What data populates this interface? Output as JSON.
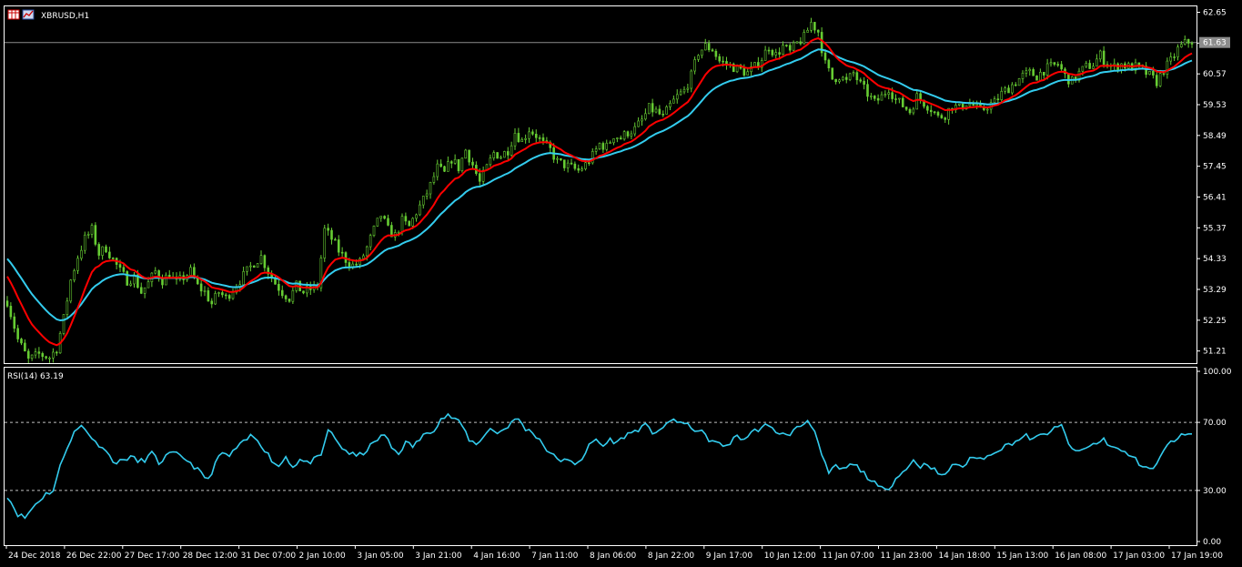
{
  "window": {
    "symbol_label": "XBRUSD,H1",
    "icons": [
      "grid-icon",
      "chart-icon"
    ]
  },
  "colors": {
    "background": "#000000",
    "frame": "#ffffff",
    "bull_candle": "#66cc33",
    "fast_ma": "#ff0000",
    "slow_ma": "#33ccee",
    "rsi_line": "#33ccee",
    "current_price_line": "#8c8c8c",
    "current_price_label_bg": "#8c8c8c"
  },
  "chart_data": [
    {
      "type": "candlestick",
      "name_label": "",
      "ylim": [
        50.8,
        62.85
      ],
      "y_ticks": [
        "62.65",
        "61.61",
        "60.57",
        "59.53",
        "58.49",
        "57.45",
        "56.41",
        "55.37",
        "54.33",
        "53.29",
        "52.25",
        "51.21"
      ],
      "current_price": 61.63,
      "current_price_label": "61.63",
      "x_ticks": [
        "24 Dec 2018",
        "26 Dec 22:00",
        "27 Dec 17:00",
        "28 Dec 12:00",
        "31 Dec 07:00",
        "2 Jan 10:00",
        "3 Jan 05:00",
        "3 Jan 21:00",
        "4 Jan 16:00",
        "7 Jan 11:00",
        "8 Jan 06:00",
        "8 Jan 22:00",
        "9 Jan 17:00",
        "10 Jan 12:00",
        "11 Jan 07:00",
        "11 Jan 23:00",
        "14 Jan 18:00",
        "15 Jan 13:00",
        "16 Jan 08:00",
        "17 Jan 03:00",
        "17 Jan 19:00"
      ],
      "close_path": [
        [
          0,
          52.9
        ],
        [
          3,
          51.6
        ],
        [
          6,
          50.9
        ],
        [
          9,
          51.1
        ],
        [
          12,
          51.0
        ],
        [
          14,
          51.3
        ],
        [
          16,
          52.3
        ],
        [
          18,
          53.6
        ],
        [
          20,
          54.4
        ],
        [
          22,
          55.0
        ],
        [
          24,
          55.3
        ],
        [
          26,
          54.5
        ],
        [
          28,
          54.7
        ],
        [
          30,
          54.3
        ],
        [
          32,
          53.9
        ],
        [
          34,
          53.6
        ],
        [
          36,
          53.7
        ],
        [
          38,
          53.2
        ],
        [
          40,
          53.5
        ],
        [
          42,
          53.9
        ],
        [
          44,
          53.6
        ],
        [
          46,
          53.8
        ],
        [
          48,
          53.5
        ],
        [
          50,
          53.7
        ],
        [
          52,
          53.9
        ],
        [
          54,
          53.4
        ],
        [
          56,
          53.2
        ],
        [
          58,
          52.8
        ],
        [
          60,
          53.2
        ],
        [
          62,
          53.0
        ],
        [
          64,
          53.3
        ],
        [
          66,
          53.6
        ],
        [
          68,
          53.9
        ],
        [
          70,
          54.2
        ],
        [
          72,
          54.4
        ],
        [
          74,
          53.9
        ],
        [
          76,
          53.5
        ],
        [
          78,
          53.2
        ],
        [
          80,
          53.0
        ],
        [
          82,
          53.4
        ],
        [
          84,
          53.2
        ],
        [
          86,
          53.3
        ],
        [
          88,
          53.4
        ],
        [
          90,
          55.3
        ],
        [
          92,
          55.0
        ],
        [
          94,
          54.6
        ],
        [
          96,
          54.3
        ],
        [
          98,
          54.1
        ],
        [
          100,
          54.2
        ],
        [
          102,
          54.7
        ],
        [
          104,
          55.3
        ],
        [
          106,
          55.8
        ],
        [
          108,
          55.3
        ],
        [
          110,
          55.1
        ],
        [
          112,
          55.6
        ],
        [
          114,
          55.4
        ],
        [
          116,
          55.9
        ],
        [
          118,
          56.3
        ],
        [
          120,
          56.8
        ],
        [
          122,
          57.4
        ],
        [
          124,
          57.2
        ],
        [
          126,
          57.7
        ],
        [
          128,
          57.4
        ],
        [
          130,
          58.0
        ],
        [
          132,
          57.5
        ],
        [
          134,
          56.9
        ],
        [
          136,
          57.4
        ],
        [
          138,
          57.9
        ],
        [
          140,
          57.8
        ],
        [
          142,
          58.0
        ],
        [
          144,
          58.6
        ],
        [
          146,
          58.3
        ],
        [
          148,
          58.7
        ],
        [
          150,
          58.5
        ],
        [
          152,
          58.2
        ],
        [
          154,
          58.0
        ],
        [
          156,
          57.6
        ],
        [
          158,
          57.5
        ],
        [
          160,
          57.4
        ],
        [
          162,
          57.3
        ],
        [
          164,
          57.5
        ],
        [
          166,
          57.8
        ],
        [
          168,
          58.2
        ],
        [
          170,
          58.1
        ],
        [
          172,
          58.5
        ],
        [
          174,
          58.4
        ],
        [
          176,
          58.6
        ],
        [
          178,
          58.7
        ],
        [
          180,
          59.0
        ],
        [
          182,
          59.4
        ],
        [
          184,
          59.3
        ],
        [
          186,
          59.1
        ],
        [
          188,
          59.5
        ],
        [
          190,
          59.8
        ],
        [
          192,
          60.0
        ],
        [
          194,
          60.5
        ],
        [
          196,
          61.3
        ],
        [
          198,
          61.5
        ],
        [
          200,
          61.4
        ],
        [
          202,
          61.0
        ],
        [
          204,
          60.9
        ],
        [
          206,
          60.8
        ],
        [
          208,
          60.7
        ],
        [
          210,
          60.6
        ],
        [
          212,
          60.8
        ],
        [
          214,
          61.1
        ],
        [
          216,
          61.5
        ],
        [
          218,
          61.2
        ],
        [
          220,
          61.5
        ],
        [
          222,
          61.3
        ],
        [
          224,
          61.6
        ],
        [
          226,
          61.8
        ],
        [
          228,
          62.3
        ],
        [
          230,
          62.0
        ],
        [
          232,
          60.9
        ],
        [
          234,
          60.4
        ],
        [
          236,
          60.5
        ],
        [
          238,
          60.3
        ],
        [
          240,
          60.6
        ],
        [
          242,
          60.2
        ],
        [
          244,
          59.9
        ],
        [
          246,
          59.6
        ],
        [
          248,
          59.8
        ],
        [
          250,
          60.1
        ],
        [
          252,
          59.7
        ],
        [
          254,
          59.5
        ],
        [
          256,
          59.3
        ],
        [
          258,
          59.8
        ],
        [
          260,
          59.6
        ],
        [
          262,
          59.4
        ],
        [
          264,
          59.1
        ],
        [
          266,
          59.2
        ],
        [
          268,
          59.5
        ],
        [
          270,
          59.4
        ],
        [
          272,
          59.6
        ],
        [
          274,
          59.5
        ],
        [
          276,
          59.3
        ],
        [
          278,
          59.5
        ],
        [
          280,
          59.6
        ],
        [
          282,
          59.9
        ],
        [
          284,
          60.1
        ],
        [
          286,
          60.3
        ],
        [
          288,
          60.5
        ],
        [
          290,
          60.6
        ],
        [
          292,
          60.5
        ],
        [
          294,
          60.7
        ],
        [
          296,
          60.8
        ],
        [
          298,
          60.9
        ],
        [
          300,
          60.5
        ],
        [
          302,
          60.3
        ],
        [
          304,
          60.6
        ],
        [
          306,
          60.8
        ],
        [
          308,
          60.9
        ],
        [
          310,
          61.2
        ],
        [
          312,
          60.9
        ],
        [
          314,
          60.8
        ],
        [
          316,
          60.9
        ],
        [
          318,
          60.8
        ],
        [
          320,
          60.8
        ],
        [
          322,
          60.7
        ],
        [
          324,
          60.5
        ],
        [
          326,
          60.3
        ],
        [
          328,
          60.7
        ],
        [
          330,
          61.0
        ],
        [
          332,
          61.4
        ],
        [
          334,
          61.6
        ],
        [
          336,
          61.7
        ]
      ],
      "candle_count": 337,
      "candle_width": 1,
      "fast_ma_period": 12,
      "slow_ma_period": 26
    },
    {
      "type": "line",
      "name_label": "RSI(14) 63.19",
      "ylim": [
        0,
        100
      ],
      "y_ticks": [
        "100.00",
        "70.00",
        "30.00",
        "0.00"
      ],
      "levels": [
        70,
        30
      ],
      "rsi_path": [
        [
          0,
          27
        ],
        [
          3,
          16
        ],
        [
          5,
          14
        ],
        [
          8,
          22
        ],
        [
          11,
          28
        ],
        [
          13,
          30
        ],
        [
          15,
          44
        ],
        [
          17,
          56
        ],
        [
          19,
          64
        ],
        [
          21,
          68
        ],
        [
          23,
          64
        ],
        [
          25,
          58
        ],
        [
          27,
          56
        ],
        [
          29,
          50
        ],
        [
          31,
          46
        ],
        [
          33,
          48
        ],
        [
          35,
          50
        ],
        [
          37,
          47
        ],
        [
          39,
          48
        ],
        [
          41,
          52
        ],
        [
          43,
          46
        ],
        [
          45,
          50
        ],
        [
          47,
          52
        ],
        [
          49,
          50
        ],
        [
          51,
          48
        ],
        [
          53,
          44
        ],
        [
          55,
          40
        ],
        [
          57,
          36
        ],
        [
          59,
          46
        ],
        [
          61,
          52
        ],
        [
          63,
          50
        ],
        [
          65,
          55
        ],
        [
          67,
          58
        ],
        [
          69,
          62
        ],
        [
          71,
          60
        ],
        [
          73,
          54
        ],
        [
          75,
          48
        ],
        [
          77,
          44
        ],
        [
          79,
          50
        ],
        [
          81,
          44
        ],
        [
          83,
          48
        ],
        [
          85,
          46
        ],
        [
          87,
          48
        ],
        [
          89,
          50
        ],
        [
          91,
          66
        ],
        [
          93,
          60
        ],
        [
          95,
          55
        ],
        [
          97,
          52
        ],
        [
          99,
          50
        ],
        [
          101,
          52
        ],
        [
          103,
          56
        ],
        [
          105,
          60
        ],
        [
          107,
          63
        ],
        [
          109,
          55
        ],
        [
          111,
          52
        ],
        [
          113,
          58
        ],
        [
          115,
          56
        ],
        [
          117,
          60
        ],
        [
          119,
          64
        ],
        [
          121,
          66
        ],
        [
          123,
          72
        ],
        [
          125,
          74
        ],
        [
          127,
          72
        ],
        [
          129,
          68
        ],
        [
          131,
          60
        ],
        [
          133,
          57
        ],
        [
          135,
          62
        ],
        [
          137,
          66
        ],
        [
          139,
          64
        ],
        [
          141,
          66
        ],
        [
          143,
          70
        ],
        [
          145,
          72
        ],
        [
          147,
          66
        ],
        [
          149,
          64
        ],
        [
          151,
          60
        ],
        [
          153,
          54
        ],
        [
          155,
          50
        ],
        [
          157,
          48
        ],
        [
          159,
          47
        ],
        [
          161,
          46
        ],
        [
          163,
          49
        ],
        [
          165,
          56
        ],
        [
          167,
          60
        ],
        [
          169,
          56
        ],
        [
          171,
          60
        ],
        [
          173,
          58
        ],
        [
          175,
          62
        ],
        [
          177,
          64
        ],
        [
          179,
          66
        ],
        [
          181,
          68
        ],
        [
          183,
          64
        ],
        [
          185,
          66
        ],
        [
          187,
          68
        ],
        [
          189,
          72
        ],
        [
          191,
          70
        ],
        [
          193,
          68
        ],
        [
          195,
          66
        ],
        [
          197,
          64
        ],
        [
          199,
          60
        ],
        [
          201,
          58
        ],
        [
          203,
          56
        ],
        [
          205,
          58
        ],
        [
          207,
          62
        ],
        [
          209,
          60
        ],
        [
          211,
          64
        ],
        [
          213,
          66
        ],
        [
          215,
          68
        ],
        [
          217,
          66
        ],
        [
          219,
          64
        ],
        [
          221,
          62
        ],
        [
          223,
          65
        ],
        [
          225,
          68
        ],
        [
          227,
          71
        ],
        [
          229,
          66
        ],
        [
          231,
          50
        ],
        [
          233,
          40
        ],
        [
          235,
          44
        ],
        [
          237,
          42
        ],
        [
          239,
          45
        ],
        [
          241,
          44
        ],
        [
          243,
          40
        ],
        [
          245,
          36
        ],
        [
          247,
          32
        ],
        [
          249,
          30
        ],
        [
          251,
          34
        ],
        [
          253,
          40
        ],
        [
          255,
          42
        ],
        [
          257,
          48
        ],
        [
          259,
          44
        ],
        [
          261,
          46
        ],
        [
          263,
          42
        ],
        [
          265,
          38
        ],
        [
          267,
          42
        ],
        [
          269,
          46
        ],
        [
          271,
          44
        ],
        [
          273,
          48
        ],
        [
          275,
          50
        ],
        [
          277,
          48
        ],
        [
          279,
          52
        ],
        [
          281,
          54
        ],
        [
          283,
          56
        ],
        [
          285,
          58
        ],
        [
          287,
          60
        ],
        [
          289,
          62
        ],
        [
          291,
          60
        ],
        [
          293,
          62
        ],
        [
          295,
          64
        ],
        [
          297,
          66
        ],
        [
          299,
          68
        ],
        [
          301,
          58
        ],
        [
          303,
          52
        ],
        [
          305,
          54
        ],
        [
          307,
          56
        ],
        [
          309,
          58
        ],
        [
          311,
          60
        ],
        [
          313,
          56
        ],
        [
          315,
          54
        ],
        [
          317,
          52
        ],
        [
          319,
          50
        ],
        [
          321,
          46
        ],
        [
          323,
          44
        ],
        [
          325,
          42
        ],
        [
          327,
          50
        ],
        [
          329,
          56
        ],
        [
          331,
          60
        ],
        [
          333,
          62
        ],
        [
          335,
          63.19
        ],
        [
          336,
          63.19
        ]
      ]
    }
  ]
}
